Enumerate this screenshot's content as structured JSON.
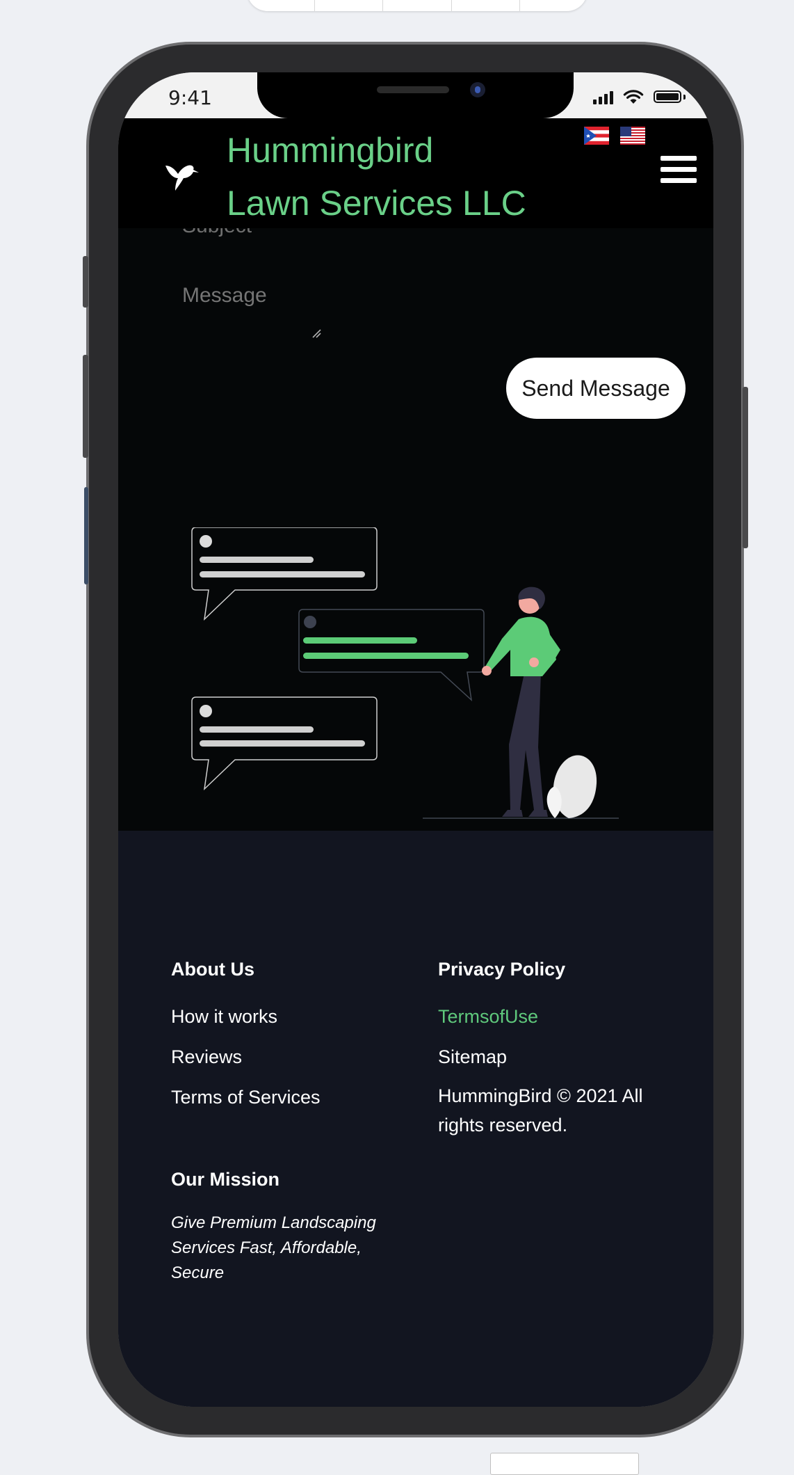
{
  "status_bar": {
    "time": "9:41"
  },
  "header": {
    "brand_line1": "Hummingbird",
    "brand_line2": "Lawn Services LLC",
    "flags": [
      "Puerto Rico flag",
      "United States flag"
    ]
  },
  "contact_form": {
    "subject_placeholder": "Subject",
    "message_placeholder": "Message",
    "send_label": "Send Message"
  },
  "footer": {
    "col1_heading": "About Us",
    "col1_links": [
      "How it works",
      "Reviews",
      "Terms of Services"
    ],
    "col2_heading": "Privacy Policy",
    "col2_links": [
      "TermsofUse",
      "Sitemap"
    ],
    "copyright": "HummingBird © 2021 All rights reserved.",
    "mission_heading": "Our Mission",
    "mission_text": "Give Premium Landscaping Services Fast, Affordable, Secure"
  },
  "colors": {
    "accent_green": "#5fc97c",
    "header_bg": "#000000",
    "footer_bg": "#121520"
  },
  "icons": [
    "hummingbird-logo-icon",
    "hamburger-menu-icon",
    "signal-icon",
    "wifi-icon",
    "battery-icon",
    "resize-grip-icon"
  ]
}
